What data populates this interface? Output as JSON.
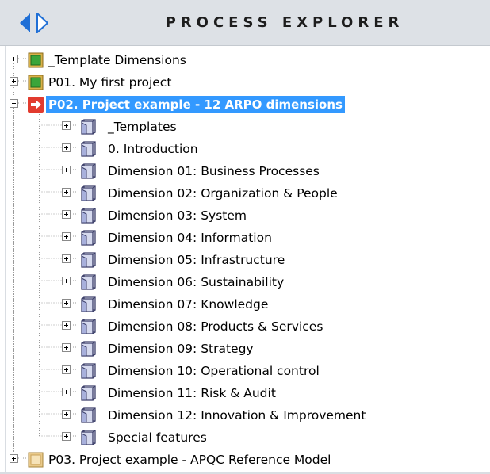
{
  "panel": {
    "title": "PROCESS EXPLORER",
    "nav_back_icon": "nav-left-arrow-icon",
    "nav_forward_icon": "nav-right-arrow-icon"
  },
  "colors": {
    "accent_blue": "#1f6fd6",
    "selection": "#3399ff",
    "project_green": "#3aa53a",
    "project_red": "#e23b2e",
    "project_tan": "#e9c98a"
  },
  "tree": {
    "projects": [
      {
        "label": "_Template Dimensions",
        "icon": "green-project-icon",
        "expanded": false,
        "selected": false
      },
      {
        "label": "P01. My first project",
        "icon": "green-project-icon",
        "expanded": false,
        "selected": false
      },
      {
        "label": "P02. Project example - 12 ARPO dimensions",
        "icon": "red-arrow-project-icon",
        "expanded": true,
        "selected": true
      },
      {
        "label": "P03. Project example - APQC Reference Model",
        "icon": "tan-project-icon",
        "expanded": false,
        "selected": false
      }
    ],
    "children": [
      {
        "label": "_Templates",
        "icon": "folder-book-icon"
      },
      {
        "label": "0. Introduction",
        "icon": "folder-book-icon"
      },
      {
        "label": "Dimension 01: Business Processes",
        "icon": "folder-book-icon"
      },
      {
        "label": "Dimension 02: Organization & People",
        "icon": "folder-book-icon"
      },
      {
        "label": "Dimension 03: System",
        "icon": "folder-book-icon"
      },
      {
        "label": "Dimension 04: Information",
        "icon": "folder-book-icon"
      },
      {
        "label": "Dimension 05: Infrastructure",
        "icon": "folder-book-icon"
      },
      {
        "label": "Dimension 06: Sustainability",
        "icon": "folder-book-icon"
      },
      {
        "label": "Dimension 07: Knowledge",
        "icon": "folder-book-icon"
      },
      {
        "label": "Dimension 08: Products & Services",
        "icon": "folder-book-icon"
      },
      {
        "label": "Dimension 09: Strategy",
        "icon": "folder-book-icon"
      },
      {
        "label": "Dimension 10: Operational control",
        "icon": "folder-book-icon"
      },
      {
        "label": "Dimension 11: Risk & Audit",
        "icon": "folder-book-icon"
      },
      {
        "label": "Dimension 12: Innovation & Improvement",
        "icon": "folder-book-icon"
      },
      {
        "label": "Special features",
        "icon": "folder-book-icon"
      }
    ]
  }
}
